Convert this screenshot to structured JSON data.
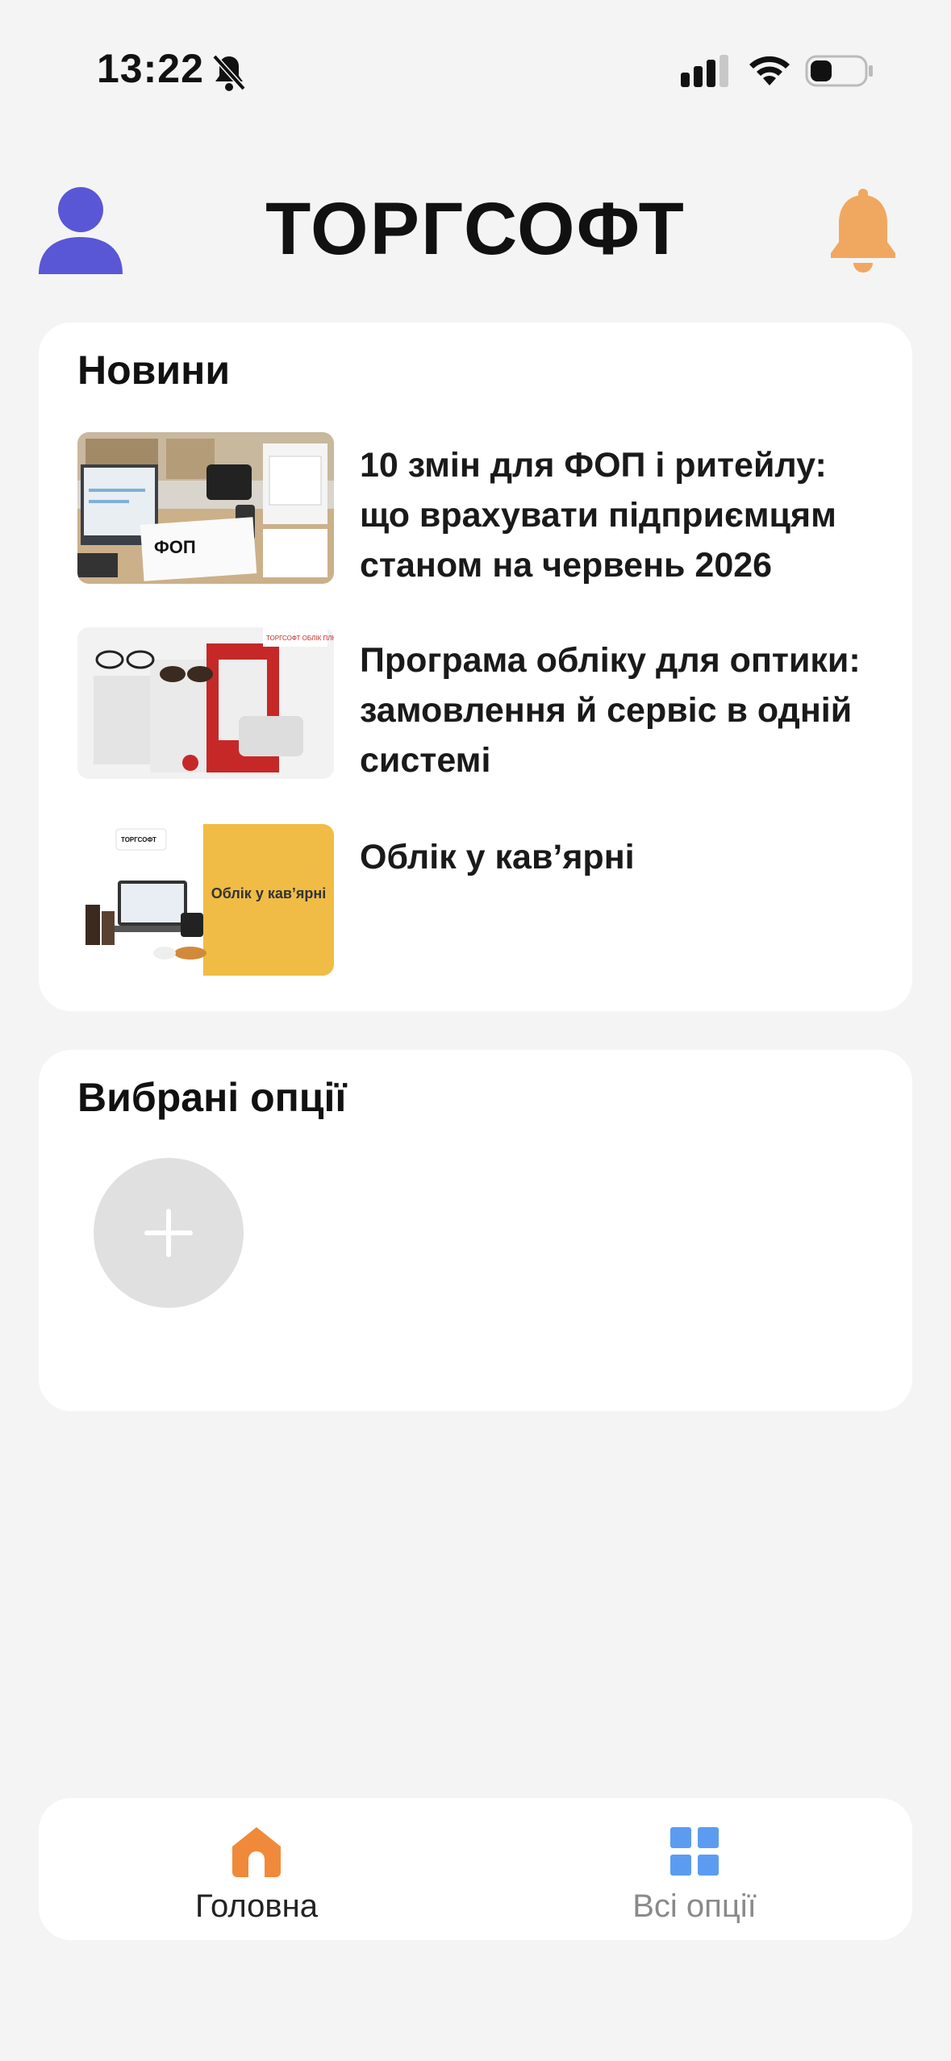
{
  "status_bar": {
    "time": "13:22"
  },
  "header": {
    "title": "ТОРГСОФТ"
  },
  "news": {
    "title": "Новини",
    "items": [
      {
        "text": "10 змін для ФОП і ритейлу: що врахувати підприємцям станом на червень 2026",
        "thumb_label": "ФОП"
      },
      {
        "text": "Програма обліку для оптики: замовлення й сервіс в одній системі",
        "thumb_label": "ТОРГСОФТ ОБЛІК ПЛЮС"
      },
      {
        "text": "Облік у кав’ярні",
        "thumb_label": "Облік у кав’ярні",
        "thumb_brand": "ТОРГСОФТ"
      }
    ]
  },
  "favorites": {
    "title": "Вибрані опції"
  },
  "bottom_nav": {
    "home_label": "Головна",
    "all_label": "Всі опції"
  },
  "colors": {
    "avatar": "#5a57d6",
    "bell": "#f0a860",
    "home_icon": "#f08a3a",
    "grid_icon": "#5c9cf0"
  }
}
